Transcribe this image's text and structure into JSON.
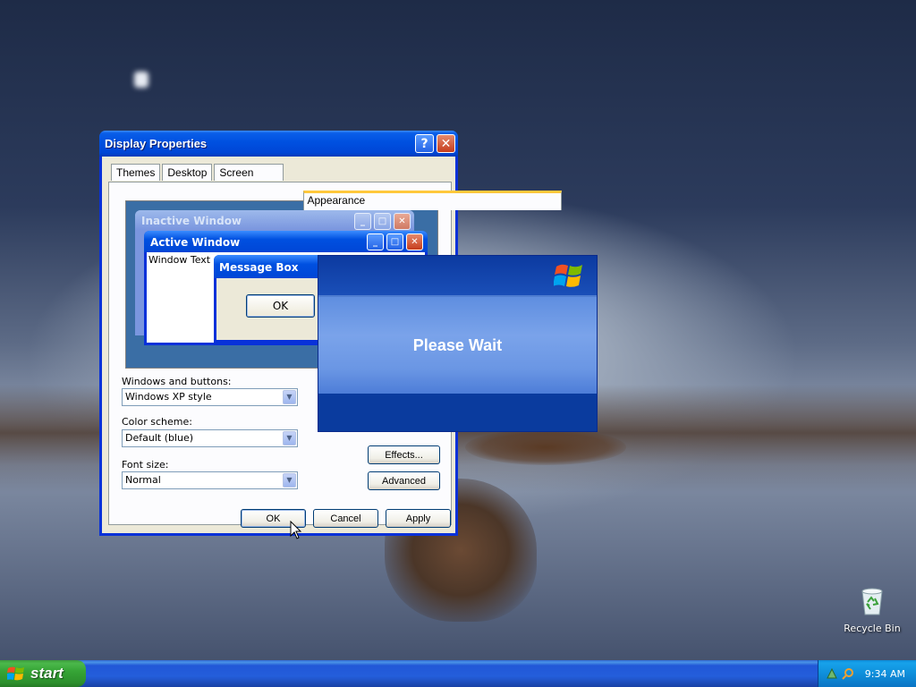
{
  "window": {
    "title": "Display Properties",
    "help_glyph": "?",
    "close_glyph": "✕",
    "tabs": [
      {
        "label": "Themes"
      },
      {
        "label": "Desktop"
      },
      {
        "label": "Screen Saver"
      },
      {
        "label": "Appearance",
        "active": true
      }
    ]
  },
  "preview": {
    "inactive_title": "Inactive Window",
    "active_title": "Active Window",
    "window_text": "Window Text",
    "msgbox_title": "Message Box",
    "msgbox_ok": "OK"
  },
  "form": {
    "windows_buttons_label": "Windows and buttons:",
    "windows_buttons_value": "Windows XP style",
    "color_scheme_label": "Color scheme:",
    "color_scheme_value": "Default (blue)",
    "font_size_label": "Font size:",
    "font_size_value": "Normal",
    "effects_button": "Effects...",
    "advanced_button": "Advanced"
  },
  "footer": {
    "ok": "OK",
    "cancel": "Cancel",
    "apply": "Apply"
  },
  "splash": {
    "message": "Please Wait"
  },
  "desktop": {
    "recycle_bin_label": "Recycle Bin"
  },
  "taskbar": {
    "start_label": "start",
    "clock": "9:34 AM"
  },
  "colors": {
    "title_blue": "#0050e0",
    "window_face": "#ece9d8",
    "start_green": "#36a536",
    "taskbar_blue": "#245edb",
    "close_red": "#c63d1c"
  }
}
